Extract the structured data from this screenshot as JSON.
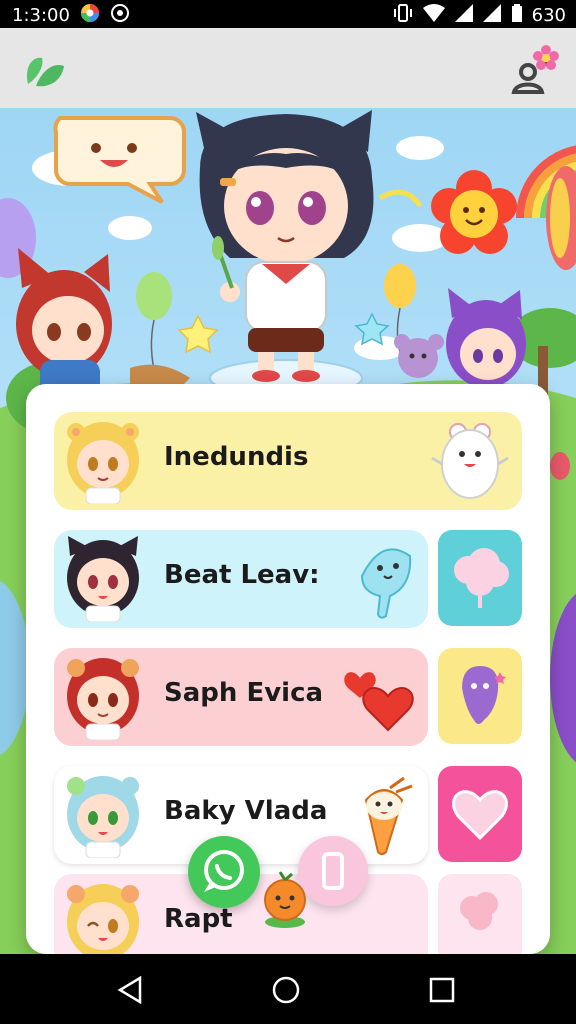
{
  "status_bar": {
    "time": "1:3:00",
    "battery": "630"
  },
  "contacts": [
    {
      "name": "Inedundis",
      "color": "#fbf1a6"
    },
    {
      "name": "Beat Leav:",
      "color": "#cff3fb"
    },
    {
      "name": "Saph Evica",
      "color": "#fcd0d3"
    },
    {
      "name": "Baky Vlada",
      "color": "#ffffff"
    },
    {
      "name": "Rapt",
      "color": "#fde4ee"
    }
  ],
  "side_buttons": [
    {
      "icon": "cloud-candy-icon",
      "color": "#5fd0d8"
    },
    {
      "icon": "ghost-icon",
      "color": "#fbe989"
    },
    {
      "icon": "heart-icon",
      "color": "#f4529a"
    },
    {
      "icon": "candy-icon",
      "color": "#fde4ee"
    }
  ],
  "colors": {
    "appbar": "#e6e6e6",
    "sky": "#a7dbf5",
    "grass": "#86cf5a",
    "accent_green": "#43c85a",
    "accent_pink": "#f9c6dd"
  }
}
